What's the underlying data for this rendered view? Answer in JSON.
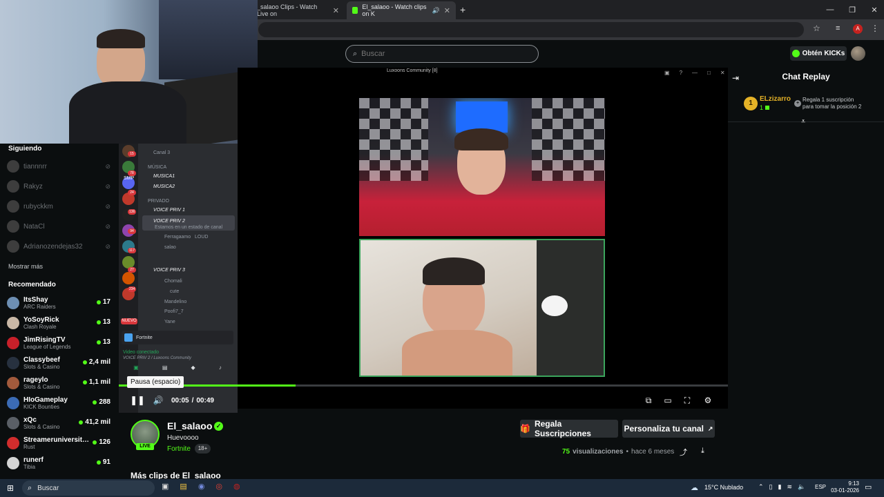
{
  "browser": {
    "tabs": [
      {
        "label": "_salaoo Clips - Watch Live on"
      },
      {
        "label": "El_salaoo - Watch clips on K"
      }
    ],
    "new_tab": "+",
    "window_controls": [
      "—",
      "❐",
      "✕"
    ]
  },
  "header": {
    "search_placeholder": "Buscar",
    "get_kicks_label": "Obtén KICKs"
  },
  "sidebar": {
    "following_title": "Siguiendo",
    "following": [
      {
        "name": "tiannnrr"
      },
      {
        "name": "Rakyz"
      },
      {
        "name": "rubyckkm"
      },
      {
        "name": "NataCl"
      },
      {
        "name": "Adrianozendejas32"
      }
    ],
    "show_more": "Mostrar más",
    "recommended_title": "Recomendado",
    "recommended": [
      {
        "name": "ItsShay",
        "category": "ARC Raiders",
        "viewers": "17",
        "avatar_color": "#6d8fb3"
      },
      {
        "name": "YoSoyRick",
        "category": "Clash Royale",
        "viewers": "13",
        "avatar_color": "#c9b8a6"
      },
      {
        "name": "JimRisingTV",
        "category": "League of Legends",
        "viewers": "13",
        "avatar_color": "#c8202a"
      },
      {
        "name": "Classybeef",
        "category": "Slots & Casino",
        "viewers": "2,4 mil",
        "avatar_color": "#27313f"
      },
      {
        "name": "rageylo",
        "category": "Slots & Casino",
        "viewers": "1,1 mil",
        "avatar_color": "#a25a3c"
      },
      {
        "name": "HIoGameplay",
        "category": "KICK Bounties",
        "viewers": "288",
        "avatar_color": "#3b6bb5"
      },
      {
        "name": "xQc",
        "category": "Slots & Casino",
        "viewers": "41,2 mil",
        "avatar_color": "#5a5f66"
      },
      {
        "name": "Streameruniversit…",
        "category": "Rust",
        "viewers": "126",
        "avatar_color": "#d12d2d"
      },
      {
        "name": "runerf",
        "category": "Tibia",
        "viewers": "91",
        "avatar_color": "#d4d4d4"
      }
    ]
  },
  "discord": {
    "channels": [
      "Canal 3",
      "MÚSICA",
      "MUSICA1",
      "MUSICA2",
      "PRIVADO",
      "VOICE PRIV 1",
      "VOICE PRIV 2",
      "Estamos en un estado de canal",
      "Ferragaamo",
      "LOUD",
      "salao",
      "VOICE PRIV 3",
      "Chomali",
      "cute",
      "Mandelino",
      "Poofi7_7",
      "Yane"
    ],
    "guild_labels": [
      "SMP",
      "NUEVO"
    ],
    "guild_badges": [
      "15",
      "78",
      "24",
      "136",
      "94",
      "117",
      "27",
      "234"
    ],
    "activity": "Fortnite",
    "voice_status": "Video conectado",
    "voice_channel": "VOICE PRIV 2 / Luxoons Community"
  },
  "video": {
    "window_title": "Luxoons Community [8]",
    "tooltip": "Pausa (espacio)",
    "time_current": "00:05",
    "time_sep": "/",
    "time_total": "00:49",
    "progress": 0.29
  },
  "chat": {
    "title": "Chat Replay",
    "rank": "1",
    "user": "ELzizarro",
    "user_count": "1",
    "message_line1": "Regala 1 suscripción",
    "message_line2": "para tomar la posición 2"
  },
  "channel": {
    "name": "El_salaoo",
    "live_badge": "LIVE",
    "clip_title": "Huevoooo",
    "category": "Fortnite",
    "age_badge": "18+",
    "gift_subs_label": "Regala Suscripciones",
    "customize_label": "Personaliza tu canal",
    "views_count": "75",
    "views_label": "visualizaciones",
    "ago": "hace 6 meses",
    "more_clips": "Más clips de El_salaoo"
  },
  "taskbar": {
    "search_label": "Buscar",
    "weather": "15°C  Nublado",
    "lang": "ESP",
    "time": "9:13",
    "date": "03-01-2026"
  },
  "colors": {
    "accent": "#53fc18",
    "bg": "#0b0e0f"
  }
}
